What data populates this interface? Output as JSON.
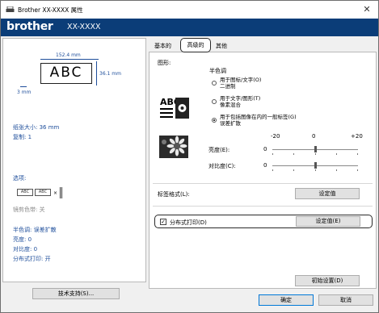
{
  "window": {
    "title": "Brother XX-XXXX 属性",
    "close_glyph": "✕"
  },
  "banner": {
    "logo": "brother",
    "model": "XX-XXXX",
    "color": "#0b3d78"
  },
  "preview": {
    "width_label": "152.4 mm",
    "height_label": "36.1 mm",
    "margin_label": "3 mm",
    "label_text": "ABC"
  },
  "info": {
    "tape_size": "纸张大小: 36 mm",
    "copies": "复制: 1",
    "options_heading": "选项:",
    "mini_cells": [
      "ABC",
      "ABC"
    ],
    "cut_mark": "×",
    "cut_line_color": "镜剪色带: 关",
    "halftone": "半色调: 误差扩散",
    "brightness": "亮度: 0",
    "contrast": "对比度: 0",
    "distributed": "分布式打印: 开"
  },
  "left_buttons": {
    "support": "技术支持(S)..."
  },
  "tabs": {
    "basic": "基本的",
    "advanced": "高级的",
    "other": "其他"
  },
  "graphics": {
    "heading": "图形:",
    "halftone_heading": "半色调",
    "options": [
      {
        "line1": "用于图标/文字(O)",
        "line2": "二进制",
        "selected": false
      },
      {
        "line1": "用于文字/图形(T)",
        "line2": "像素混合",
        "selected": false
      },
      {
        "line1": "用于包括图像在内的一般标签(G)",
        "line2": "误差扩散",
        "selected": true
      }
    ],
    "icon_text": "ABC",
    "scale": {
      "min": "-20",
      "mid": "0",
      "max": "+20"
    },
    "brightness_label": "亮度(E):",
    "brightness_value": "0",
    "brightness_level": 0,
    "contrast_label": "对比度(C):",
    "contrast_value": "0",
    "contrast_level": 0
  },
  "label_format": {
    "label": "标签格式(L):",
    "button": "设定值"
  },
  "split_print": {
    "checked": true,
    "check_glyph": "✓",
    "label": "分布式打印(D)",
    "button": "设定值(E)"
  },
  "defaults_button": "初始设置(D)",
  "dialog_buttons": {
    "ok": "确定",
    "cancel": "取消"
  }
}
